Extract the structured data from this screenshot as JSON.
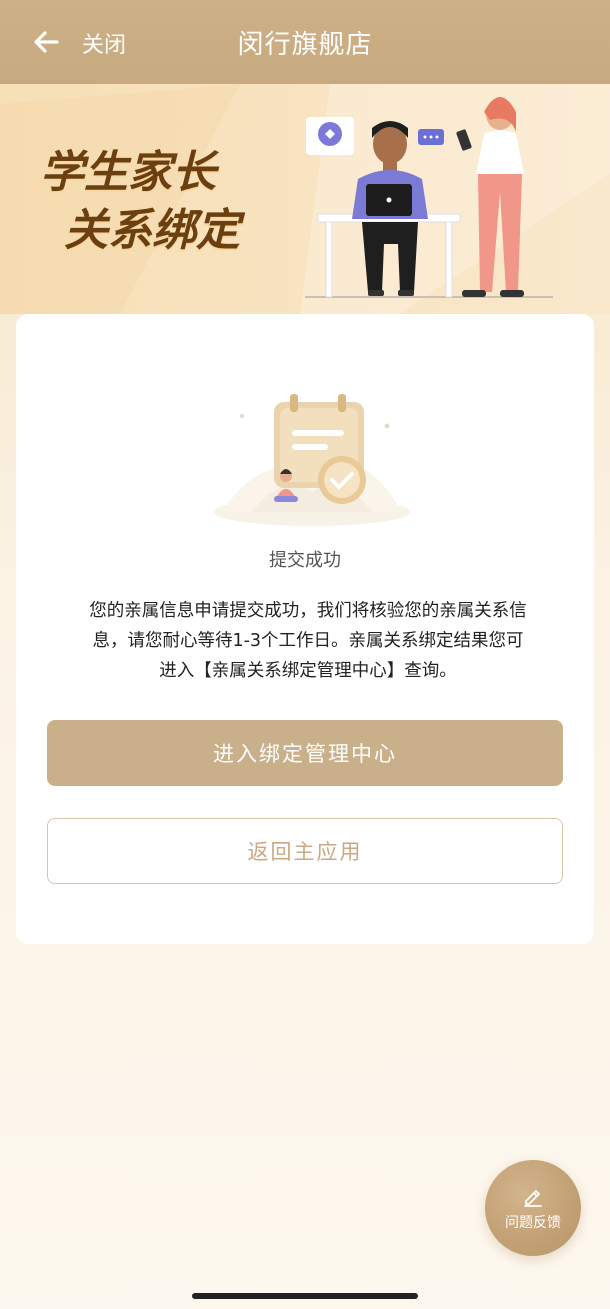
{
  "header": {
    "close_label": "关闭",
    "title": "闵行旗舰店"
  },
  "banner": {
    "title_line1": "学生家长",
    "title_line2": "关系绑定"
  },
  "result": {
    "status": "提交成功",
    "message": "您的亲属信息申请提交成功，我们将核验您的亲属关系信息，请您耐心等待1-3个工作日。亲属关系绑定结果您可进入【亲属关系绑定管理中心】查询。"
  },
  "actions": {
    "primary_label": "进入绑定管理中心",
    "secondary_label": "返回主应用"
  },
  "feedback": {
    "label": "问题反馈"
  },
  "colors": {
    "header_bg": "#c8aa80",
    "primary_button": "#c9b08a",
    "banner_title": "#6b3f10",
    "secondary_text": "#c9a982"
  }
}
